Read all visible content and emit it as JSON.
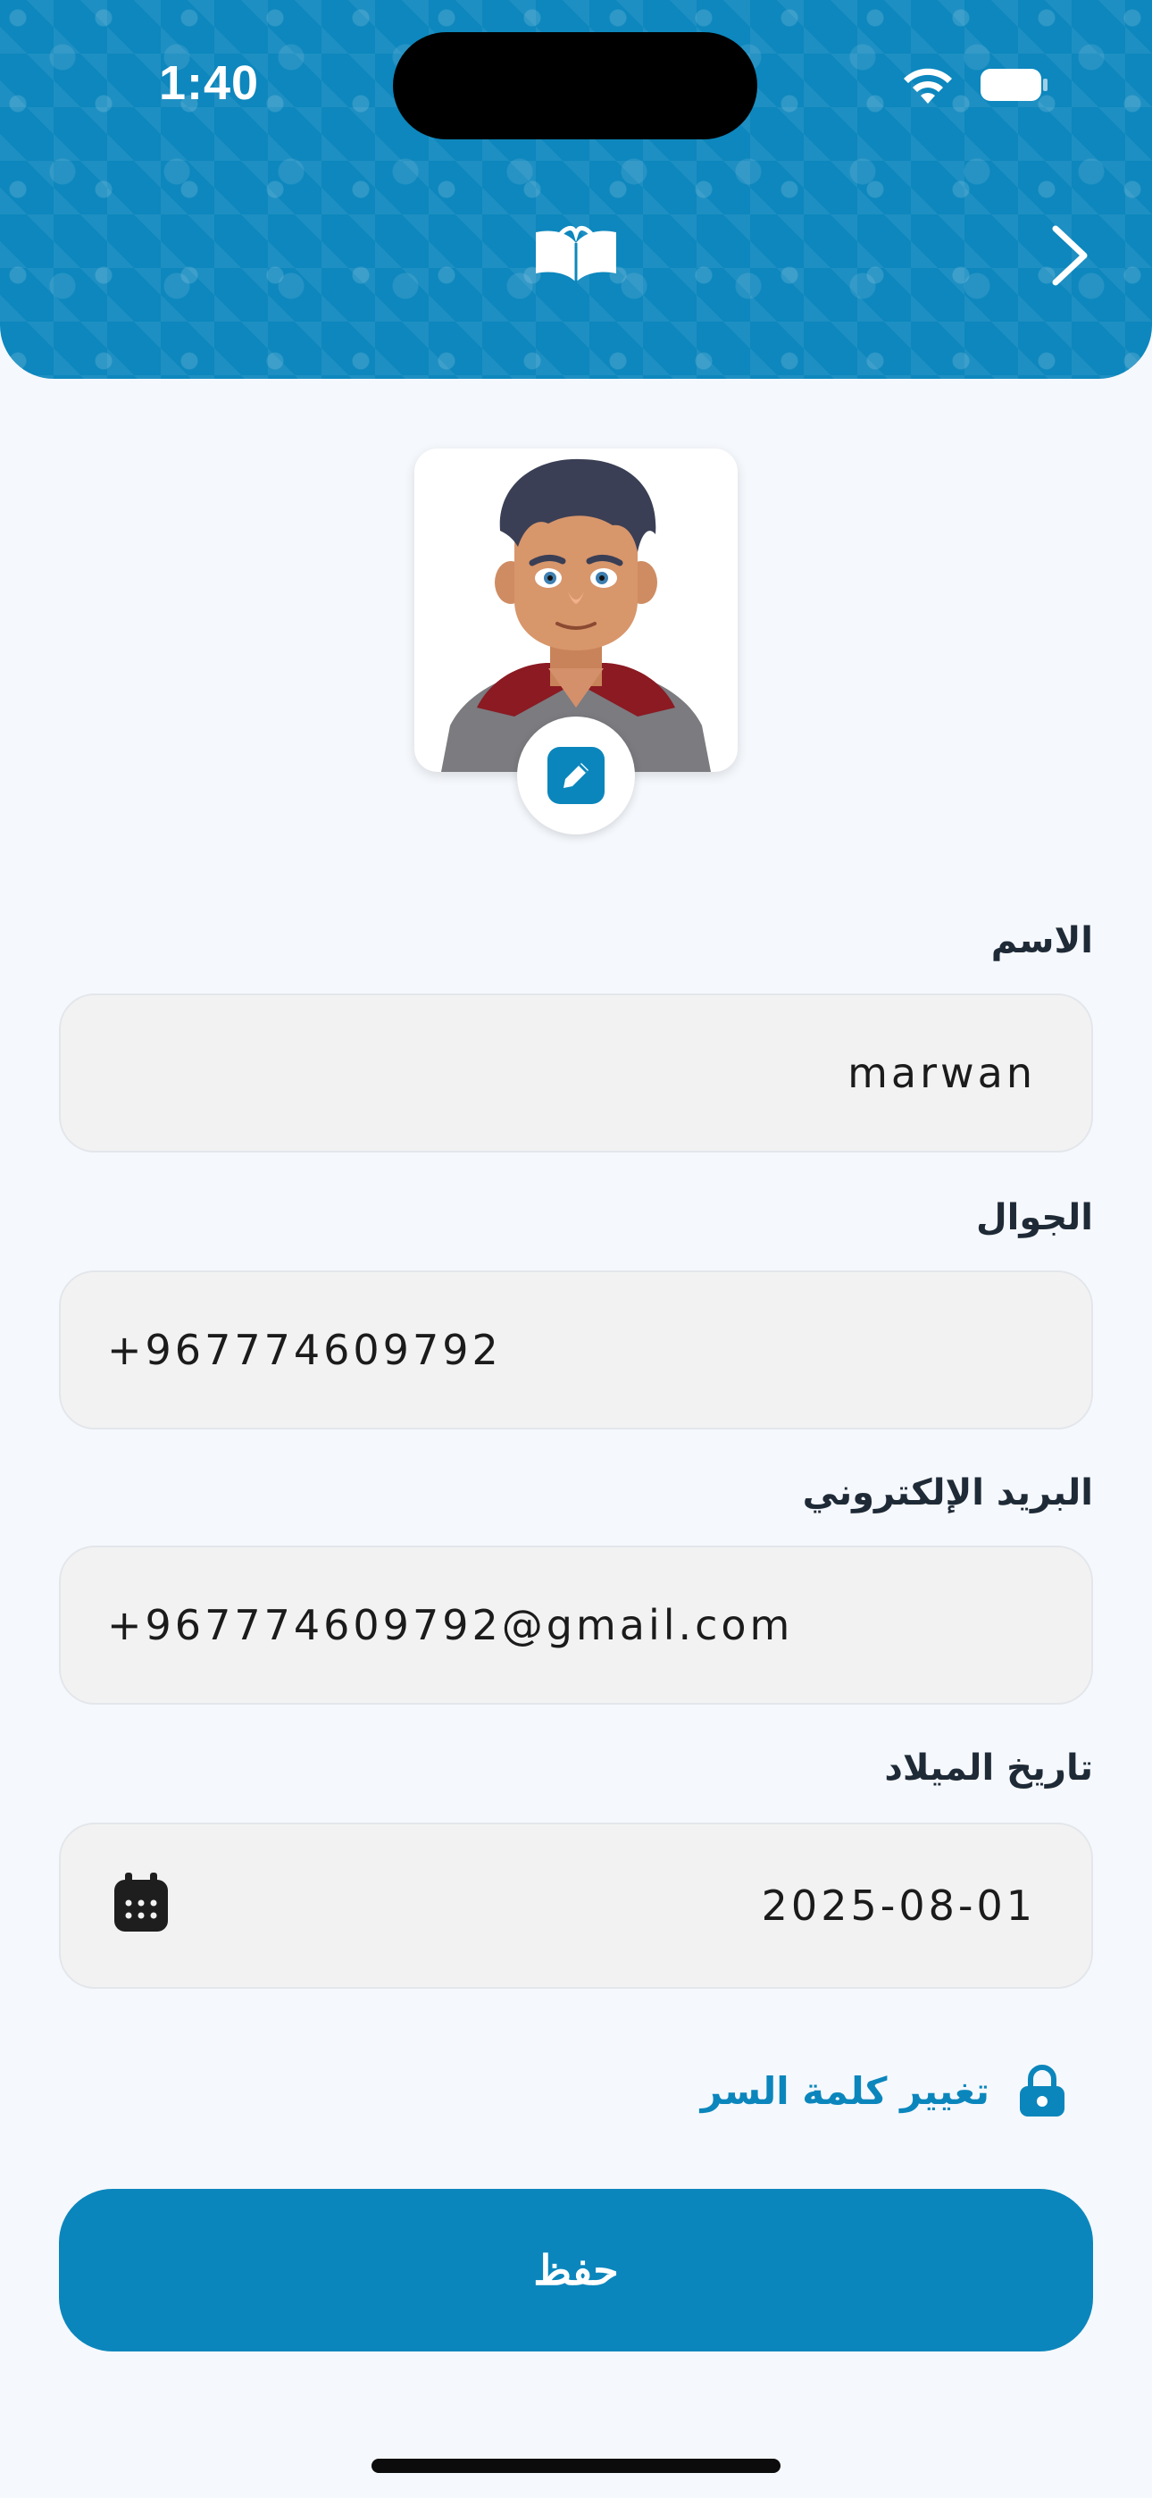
{
  "status_bar": {
    "time": "1:40"
  },
  "header": {
    "logo_icon": "open-book-icon",
    "back_icon": "chevron-right-icon",
    "background_color": "#0d87bd"
  },
  "avatar": {
    "edit_icon": "pencil-icon"
  },
  "form": {
    "name": {
      "label": "الاسم",
      "value": "marwan"
    },
    "phone": {
      "label": "الجوال",
      "value": "+967774609792"
    },
    "email": {
      "label": "البريد الإلكتروني",
      "value": "+967774609792@gmail.com"
    },
    "birthdate": {
      "label": "تاريخ الميلاد",
      "value": "2025-08-01",
      "icon": "calendar-icon"
    }
  },
  "change_password": {
    "label": "تغيير كلمة السر",
    "icon": "lock-icon"
  },
  "save_button": {
    "label": "حفظ"
  },
  "colors": {
    "primary": "#0b86bc",
    "background": "#f5f8fc",
    "field_background": "#f2f2f2"
  }
}
